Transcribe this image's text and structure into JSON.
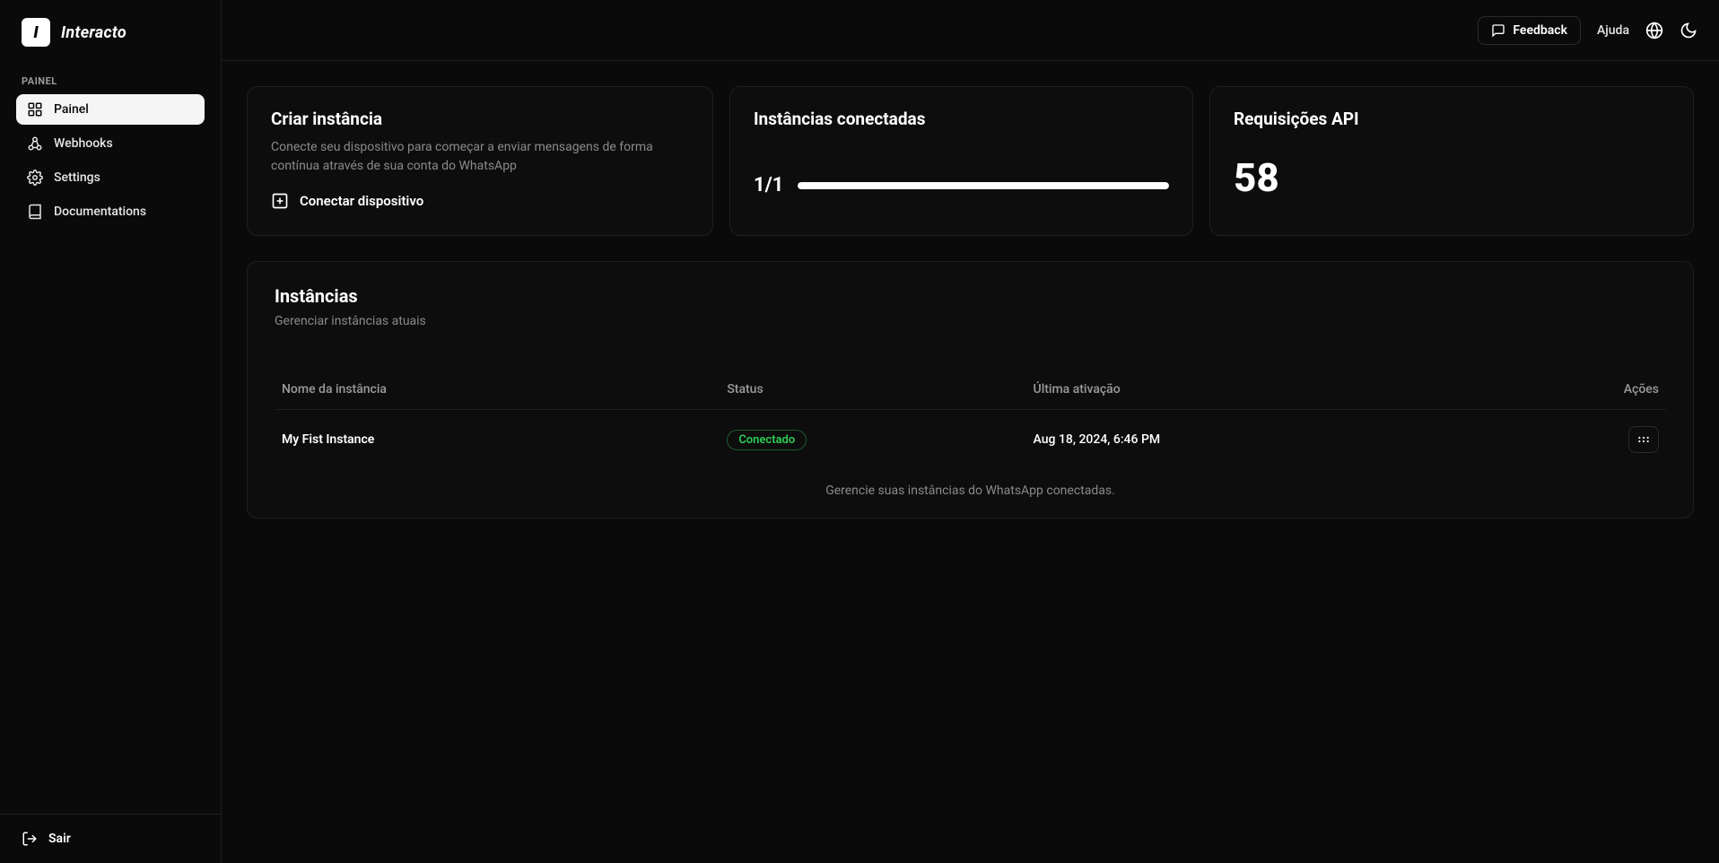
{
  "app": {
    "name": "Interacto",
    "logo_letter": "I"
  },
  "sidebar": {
    "section_label": "PAINEL",
    "items": [
      {
        "label": "Painel"
      },
      {
        "label": "Webhooks"
      },
      {
        "label": "Settings"
      },
      {
        "label": "Documentations"
      }
    ],
    "logout_label": "Sair"
  },
  "topbar": {
    "feedback_label": "Feedback",
    "help_label": "Ajuda"
  },
  "cards": {
    "create": {
      "title": "Criar instância",
      "desc": "Conecte seu dispositivo para começar a enviar mensagens de forma contínua através de sua conta do WhatsApp",
      "button_label": "Conectar dispositivo"
    },
    "connected": {
      "title": "Instâncias conectadas",
      "ratio": "1/1",
      "progress_percent": 100
    },
    "api": {
      "title": "Requisições API",
      "value": "58"
    }
  },
  "instances": {
    "title": "Instâncias",
    "subtitle": "Gerenciar instâncias atuais",
    "columns": {
      "name": "Nome da instância",
      "status": "Status",
      "last": "Última ativação",
      "actions": "Ações"
    },
    "rows": [
      {
        "name": "My Fist Instance",
        "status": "Conectado",
        "last": "Aug 18, 2024, 6:46 PM"
      }
    ],
    "footer_note": "Gerencie suas instâncias do WhatsApp conectadas."
  }
}
